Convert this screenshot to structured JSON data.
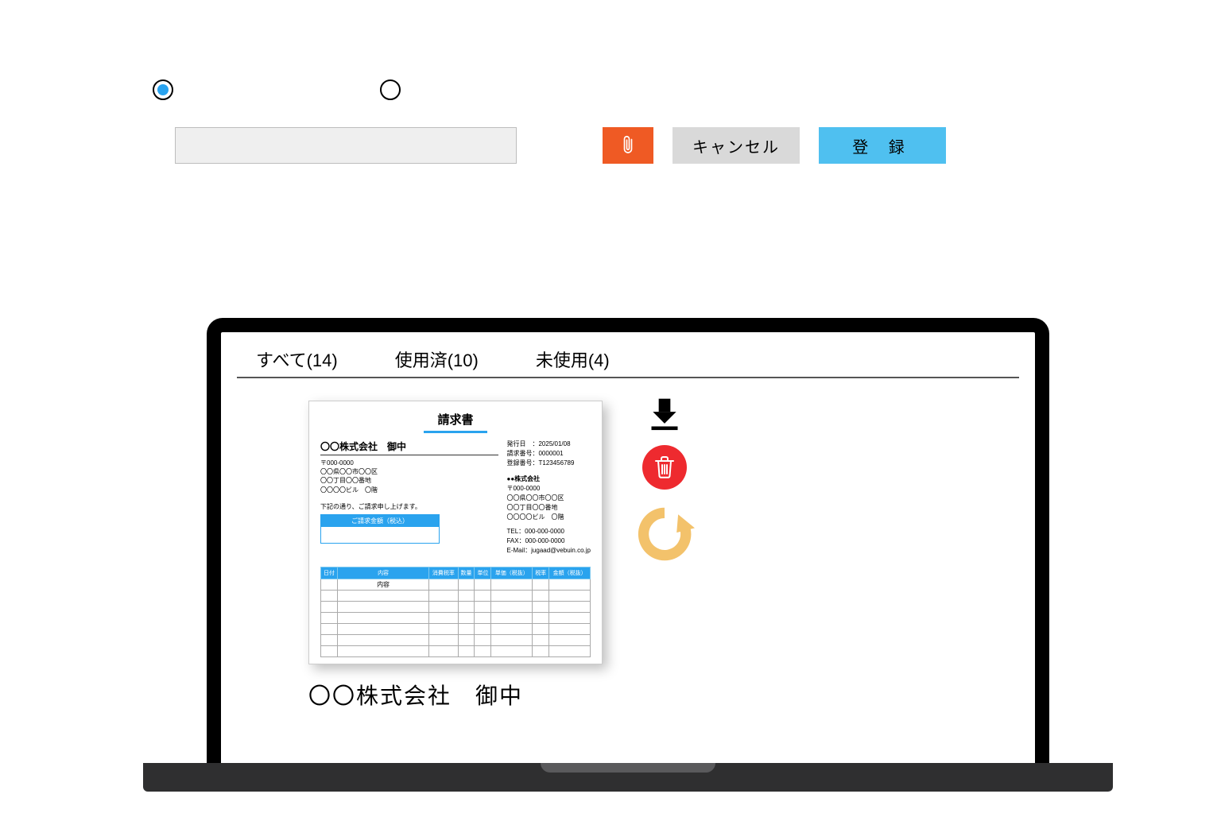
{
  "form": {
    "radio": {
      "option1_selected": true
    },
    "buttons": {
      "cancel": "キャンセル",
      "register": "登 録"
    }
  },
  "tabs": {
    "all": "すべて(14)",
    "used": "使用済(10)",
    "unused": "未使用(4)"
  },
  "invoice": {
    "title": "請求書",
    "client": "〇〇株式会社　御中",
    "client_addr": [
      "〒000-0000",
      "〇〇県〇〇市〇〇区",
      "〇〇丁目〇〇番地",
      "〇〇〇〇ビル　〇階"
    ],
    "issue": {
      "date_label": "発行日　：",
      "date": "2025/01/08",
      "number_label": "請求番号：",
      "number": "0000001",
      "reg_label": "登録番号：",
      "reg": "T123456789"
    },
    "sender": {
      "name": "●●株式会社",
      "addr": [
        "〒000-0000",
        "〇〇県〇〇市〇〇区",
        "〇〇丁目〇〇番地",
        "〇〇〇〇ビル　〇階"
      ],
      "tel_label": "TEL：",
      "tel": "000-000-0000",
      "fax_label": "FAX：",
      "fax": "000-000-0000",
      "email_label": "E-Mail：",
      "email": "jugaad@vebuin.co.jp"
    },
    "note": "下記の通り、ご請求申し上げます。",
    "amount_label": "ご請求金額（税込）",
    "table": {
      "headers": [
        "日付",
        "内容",
        "消費税率",
        "数量",
        "単位",
        "単価（税抜）",
        "税率",
        "金額（税抜）"
      ],
      "subhead": "内容"
    }
  },
  "caption": "〇〇株式会社　御中"
}
